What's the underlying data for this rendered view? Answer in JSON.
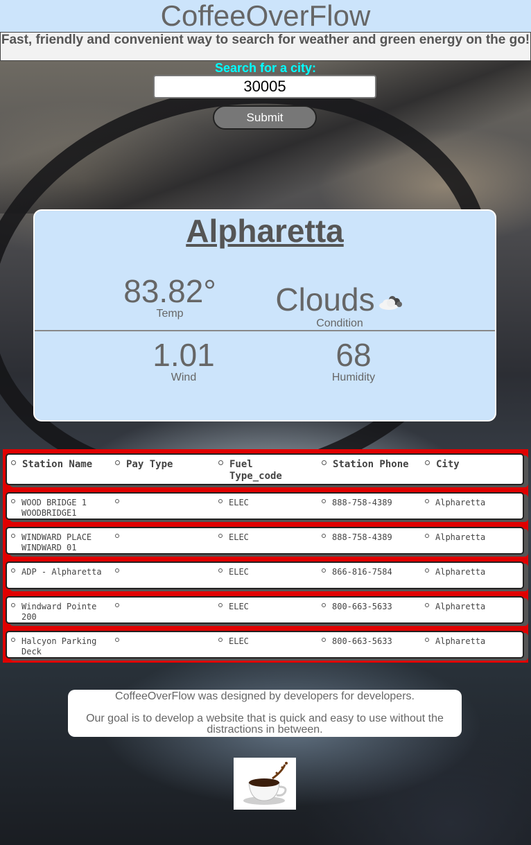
{
  "header": {
    "title": "CoffeeOverFlow",
    "tagline": "Fast, friendly and convenient way to search for weather and green energy on the go!"
  },
  "search": {
    "label": "Search for a city:",
    "value": "30005",
    "submit_label": "Submit"
  },
  "weather": {
    "city": "Alpharetta",
    "temp_value": "83.82°",
    "temp_label": "Temp",
    "condition_value": "Clouds",
    "condition_label": "Condition",
    "condition_icon": "cloud-icon",
    "wind_value": "1.01",
    "wind_label": "Wind",
    "humidity_value": "68",
    "humidity_label": "Humidity"
  },
  "stations": {
    "headers": [
      "Station Name",
      "Pay Type",
      "Fuel Type_code",
      "Station Phone",
      "City"
    ],
    "rows": [
      [
        "WOOD BRIDGE 1 WOODBRIDGE1",
        "",
        "ELEC",
        "888-758-4389",
        "Alpharetta"
      ],
      [
        "WINDWARD PLACE WINDWARD 01",
        "",
        "ELEC",
        "888-758-4389",
        "Alpharetta"
      ],
      [
        "ADP - Alpharetta",
        "",
        "ELEC",
        "866-816-7584",
        "Alpharetta"
      ],
      [
        "Windward Pointe 200",
        "",
        "ELEC",
        "800-663-5633",
        "Alpharetta"
      ],
      [
        "Halcyon Parking Deck",
        "",
        "ELEC",
        "800-663-5633",
        "Alpharetta"
      ]
    ]
  },
  "about": {
    "line1": "CoffeeOverFlow was designed by developers for developers.",
    "line2": "Our goal is to develop a website that is quick and easy to use without the distractions in between."
  },
  "colors": {
    "header_bg": "#cce4fb",
    "search_label": "#00ffff",
    "stations_border": "#e00000"
  }
}
